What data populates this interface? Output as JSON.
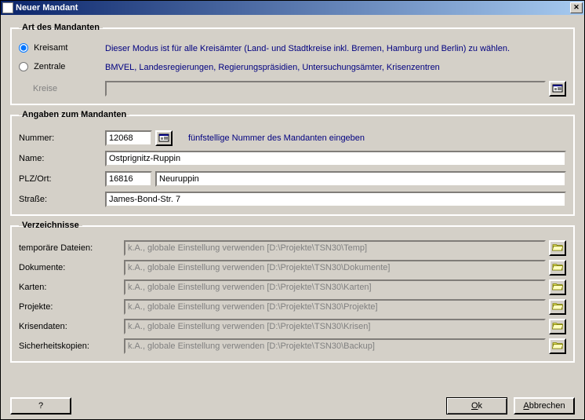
{
  "window": {
    "title": "Neuer Mandant"
  },
  "group1": {
    "legend": "Art des Mandanten",
    "opt1": {
      "label": "Kreisamt",
      "desc": "Dieser Modus ist für alle Kreisämter (Land- und Stadtkreise inkl. Bremen, Hamburg und Berlin) zu wählen."
    },
    "opt2": {
      "label": "Zentrale",
      "desc": "BMVEL, Landesregierungen, Regierungspräsidien, Untersuchungsämter, Krisenzentren"
    },
    "kreise_label": "Kreise"
  },
  "group2": {
    "legend": "Angaben zum Mandanten",
    "nummer_label": "Nummer:",
    "nummer_value": "12068",
    "nummer_hint": "fünfstellige Nummer des Mandanten eingeben",
    "name_label": "Name:",
    "name_value": "Ostprignitz-Ruppin",
    "plzort_label": "PLZ/Ort:",
    "plz_value": "16816",
    "ort_value": "Neuruppin",
    "strasse_label": "Straße:",
    "strasse_value": "James-Bond-Str. 7"
  },
  "group3": {
    "legend": "Verzeichnisse",
    "rows": [
      {
        "label": "temporäre Dateien:",
        "value": "k.A., globale Einstellung verwenden [D:\\Projekte\\TSN30\\Temp]"
      },
      {
        "label": "Dokumente:",
        "value": "k.A., globale Einstellung verwenden [D:\\Projekte\\TSN30\\Dokumente]"
      },
      {
        "label": "Karten:",
        "value": "k.A., globale Einstellung verwenden [D:\\Projekte\\TSN30\\Karten]"
      },
      {
        "label": "Projekte:",
        "value": "k.A., globale Einstellung verwenden [D:\\Projekte\\TSN30\\Projekte]"
      },
      {
        "label": "Krisendaten:",
        "value": "k.A., globale Einstellung verwenden [D:\\Projekte\\TSN30\\Krisen]"
      },
      {
        "label": "Sicherheitskopien:",
        "value": "k.A., globale Einstellung verwenden [D:\\Projekte\\TSN30\\Backup]"
      }
    ]
  },
  "buttons": {
    "help": "?",
    "ok": "Ok",
    "cancel": "Abbrechen"
  }
}
